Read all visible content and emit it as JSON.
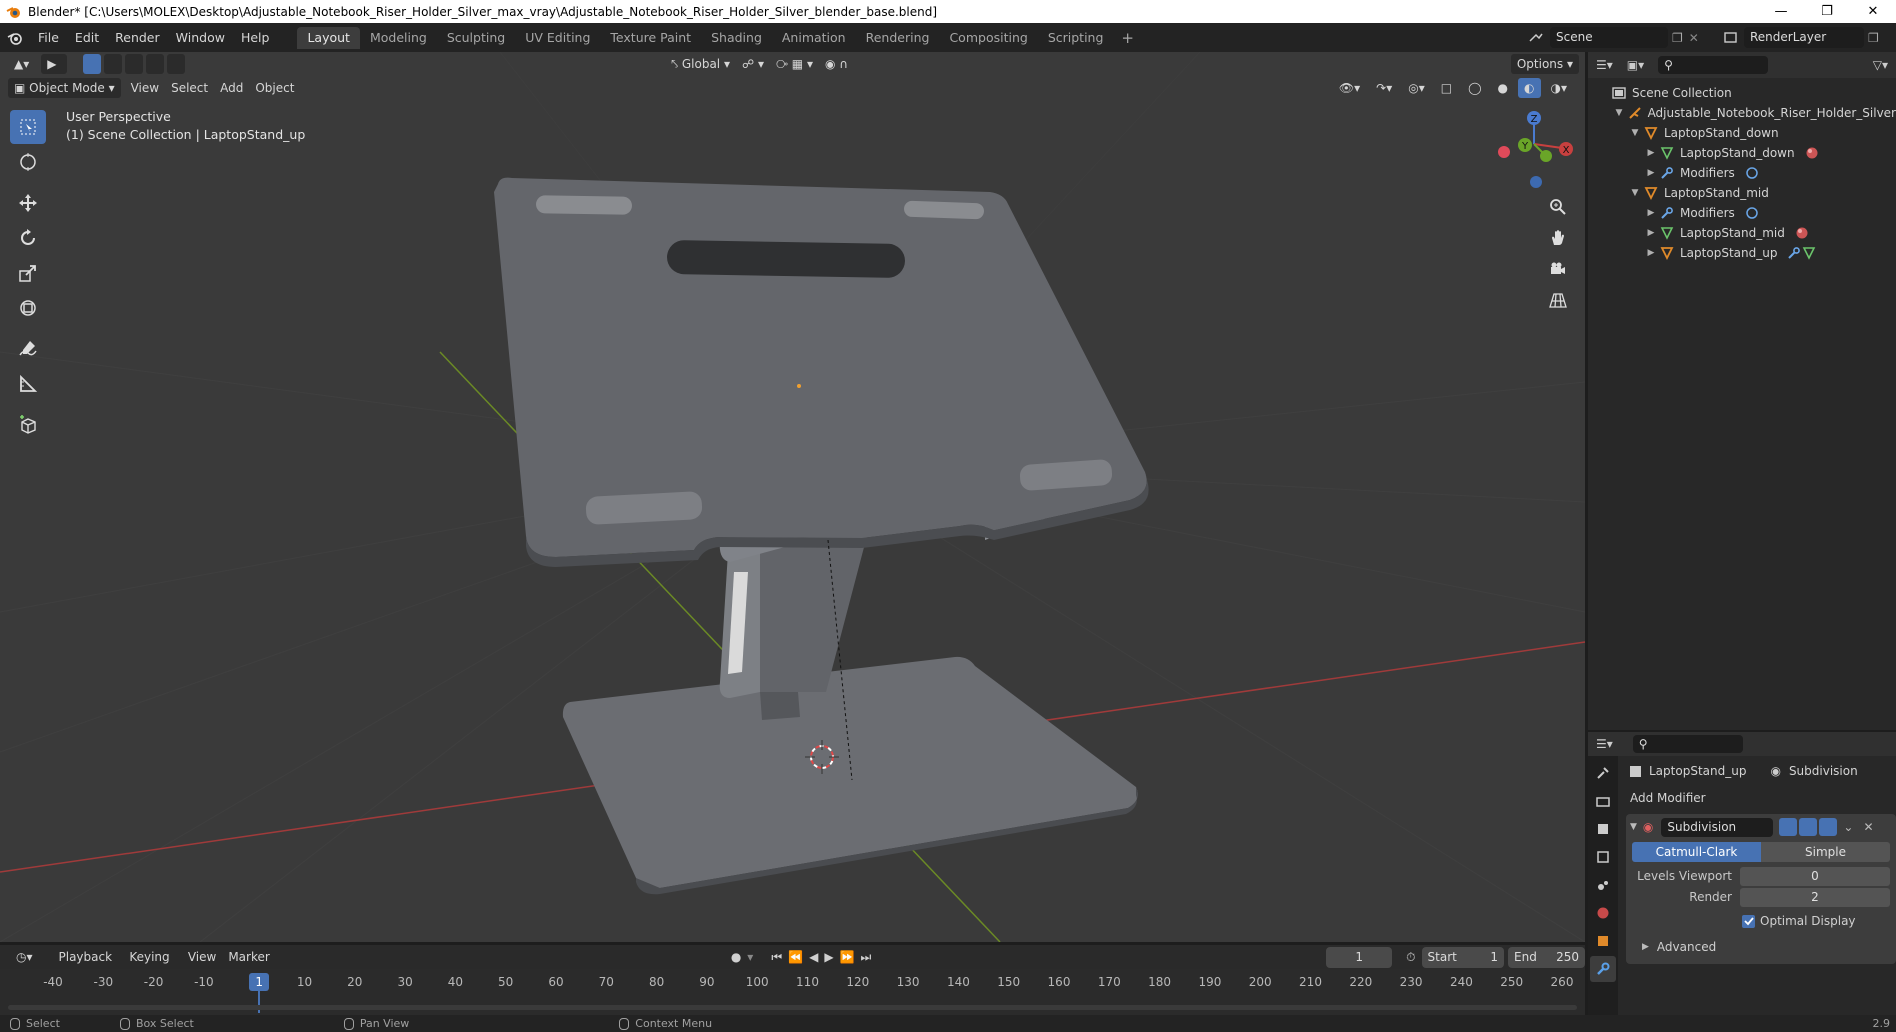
{
  "window": {
    "title": "Blender* [C:\\Users\\MOLEX\\Desktop\\Adjustable_Notebook_Riser_Holder_Silver_max_vray\\Adjustable_Notebook_Riser_Holder_Silver_blender_base.blend]",
    "controls": [
      "minimize-icon",
      "restore-icon",
      "close-icon"
    ]
  },
  "menu": [
    "File",
    "Edit",
    "Render",
    "Window",
    "Help"
  ],
  "workspaces": [
    {
      "label": "Layout",
      "active": true
    },
    {
      "label": "Modeling"
    },
    {
      "label": "Sculpting"
    },
    {
      "label": "UV Editing"
    },
    {
      "label": "Texture Paint"
    },
    {
      "label": "Shading"
    },
    {
      "label": "Animation"
    },
    {
      "label": "Rendering"
    },
    {
      "label": "Compositing"
    },
    {
      "label": "Scripting"
    }
  ],
  "workspace_add": "+",
  "scene": {
    "name": "Scene",
    "view_layer": "RenderLayer"
  },
  "viewport": {
    "mode": "Object Mode",
    "menus": [
      "View",
      "Select",
      "Add",
      "Object"
    ],
    "orientation": "Global",
    "options_label": "Options",
    "info_line1": "User Perspective",
    "info_line2": "(1) Scene Collection | LaptopStand_up",
    "gizmo_axes": {
      "z": "Z",
      "y": "Y",
      "x": "X"
    },
    "colors": {
      "bg": "#3a3a3a",
      "x_axis": "#c04848",
      "y_axis": "#7a9a2e",
      "model": "#6b6d72"
    }
  },
  "outliner": {
    "rows": [
      {
        "label": "Scene Collection",
        "depth": 0,
        "icon": "scene-collection-icon"
      },
      {
        "label": "Adjustable_Notebook_Riser_Holder_Silver",
        "depth": 1,
        "icon": "armature-icon",
        "expanded": true
      },
      {
        "label": "LaptopStand_down",
        "depth": 2,
        "icon": "object-icon",
        "expanded": true
      },
      {
        "label": "LaptopStand_down",
        "depth": 3,
        "icon": "mesh-icon",
        "extra": "material-icon"
      },
      {
        "label": "Modifiers",
        "depth": 3,
        "icon": "wrench-icon",
        "extra": "modifier-icon"
      },
      {
        "label": "LaptopStand_mid",
        "depth": 2,
        "icon": "object-icon",
        "expanded": true
      },
      {
        "label": "Modifiers",
        "depth": 3,
        "icon": "wrench-icon",
        "extra": "modifier-icon"
      },
      {
        "label": "LaptopStand_mid",
        "depth": 3,
        "icon": "mesh-icon",
        "extra": "material-icon"
      },
      {
        "label": "LaptopStand_up",
        "depth": 3,
        "icon": "object-icon",
        "extra": "wrench-mesh-icon"
      }
    ]
  },
  "properties": {
    "object_name": "LaptopStand_up",
    "modifier_name_header": "Subdivision",
    "add_modifier": "Add Modifier",
    "modifier": {
      "name": "Subdivision",
      "type_options": [
        "Catmull-Clark",
        "Simple"
      ],
      "selected_type": "Catmull-Clark",
      "levels_viewport_label": "Levels Viewport",
      "levels_viewport": "0",
      "render_label": "Render",
      "render": "2",
      "optimal_display_label": "Optimal Display",
      "optimal_display": true,
      "advanced_label": "Advanced"
    }
  },
  "timeline": {
    "menus": [
      "Playback",
      "Keying",
      "View",
      "Marker"
    ],
    "current_frame": "1",
    "start_label": "Start",
    "start": "1",
    "end_label": "End",
    "end": "250",
    "ticks": [
      "-40",
      "-30",
      "-20",
      "-10",
      "1",
      "10",
      "20",
      "30",
      "40",
      "50",
      "60",
      "70",
      "80",
      "90",
      "100",
      "110",
      "120",
      "130",
      "140",
      "150",
      "160",
      "170",
      "180",
      "190",
      "200",
      "210",
      "220",
      "230",
      "240",
      "250",
      "260"
    ]
  },
  "statusbar": {
    "items": [
      "Select",
      "Box Select",
      "Pan View",
      "Context Menu"
    ],
    "version": "2.9"
  }
}
